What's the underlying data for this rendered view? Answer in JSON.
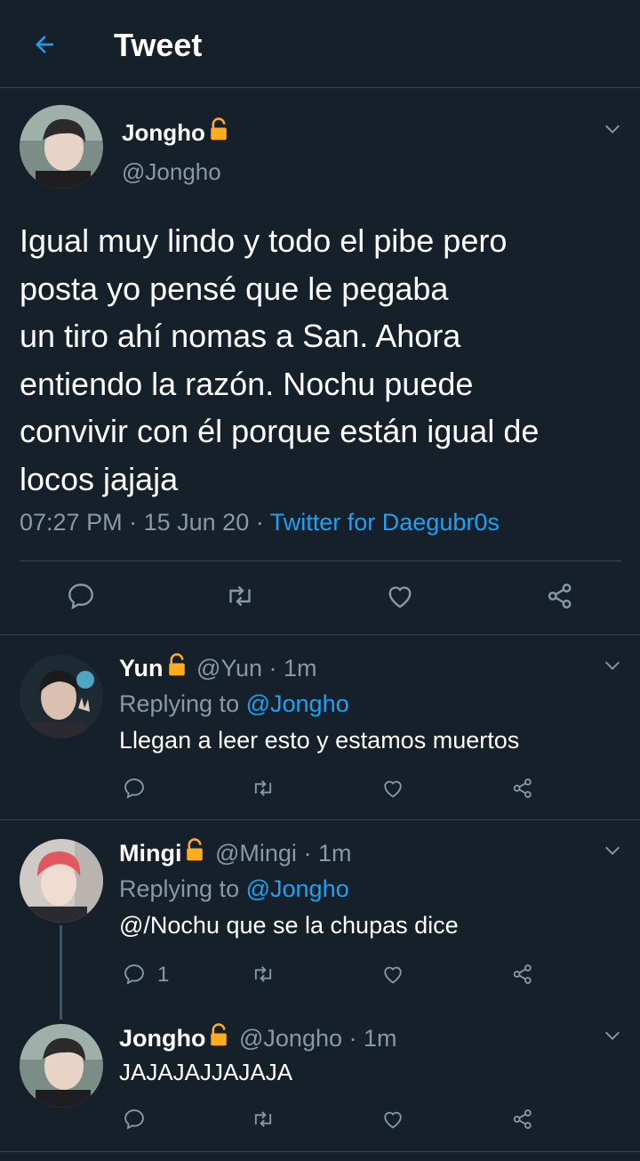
{
  "header": {
    "title": "Tweet",
    "back_icon": "arrow-left-icon"
  },
  "main_tweet": {
    "name": "Jongho",
    "handle": "@Jongho",
    "text_lines": [
      "Igual muy lindo y todo el pibe pero",
      "posta yo pensé que le pegaba",
      "un tiro ahí nomas a San. Ahora",
      "entiendo la razón. Nochu puede",
      "convivir con él porque están igual de",
      "locos jajaja"
    ],
    "time": "07:27 PM",
    "sep1": "·",
    "date": "15 Jun 20",
    "sep2": "·",
    "source": "Twitter for Daegubr0s"
  },
  "replies": [
    {
      "name": "Yun",
      "handle": "@Yun",
      "time": "· 1m",
      "replying_prefix": "Replying to",
      "replying_handle": "@Jongho",
      "text": "Llegan a leer esto y estamos muertos",
      "reply_count": ""
    },
    {
      "name": "Mingi",
      "handle": "@Mingi",
      "time": "· 1m",
      "replying_prefix": "Replying to",
      "replying_handle": "@Jongho",
      "text": "@/Nochu que se la chupas dice",
      "reply_count": "1"
    },
    {
      "name": "Jongho",
      "handle": "@Jongho",
      "time": "· 1m",
      "text": "JAJAJAJJAJAJA",
      "reply_count": ""
    }
  ],
  "colors": {
    "background": "#15202b",
    "accent": "#1da1f2",
    "muted": "#8899a6",
    "border": "#38444d",
    "lock": "#ffad1f"
  }
}
